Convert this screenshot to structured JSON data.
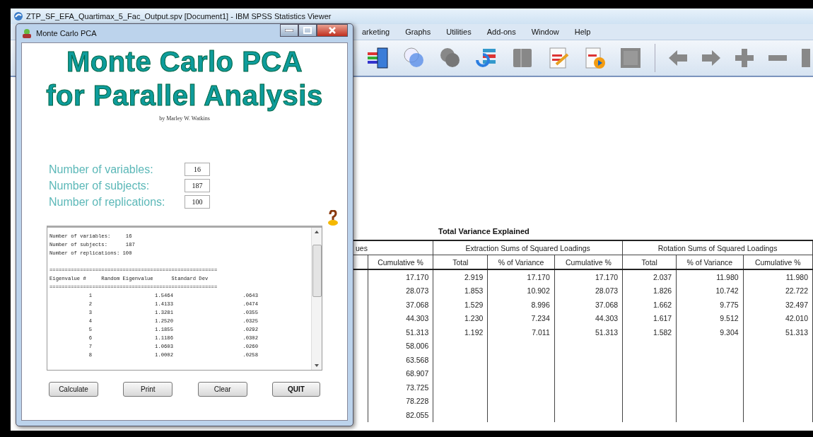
{
  "window": {
    "title": "ZTP_SF_EFA_Quartimax_5_Fac_Output.spv [Document1] - IBM SPSS Statistics Viewer"
  },
  "menu": [
    {
      "label": "arketing"
    },
    {
      "label": "Graphs"
    },
    {
      "label": "Utilities"
    },
    {
      "label": "Add-ons"
    },
    {
      "label": "Window"
    },
    {
      "label": "Help"
    }
  ],
  "dialog": {
    "title": "Monte Carlo PCA",
    "heading": [
      "Monte Carlo PCA",
      "for Parallel Analysis"
    ],
    "byline": "by Marley W. Watkins",
    "fields": [
      {
        "label": "Number of variables:",
        "value": "16"
      },
      {
        "label": "Number of subjects:",
        "value": "187"
      },
      {
        "label": "Number of replications:",
        "value": "100"
      }
    ],
    "output": {
      "info": [
        "Number of variables:     16",
        "Number of subjects:      187",
        "Number of replications: 100"
      ],
      "separator": "=======================================================",
      "header": "Eigenvalue #     Random Eigenvalue      Standard Dev",
      "rows": [
        [
          "1",
          "1.5464",
          ".0643"
        ],
        [
          "2",
          "1.4133",
          ".0474"
        ],
        [
          "3",
          "1.3281",
          ".0355"
        ],
        [
          "4",
          "1.2520",
          ".0325"
        ],
        [
          "5",
          "1.1855",
          ".0292"
        ],
        [
          "6",
          "1.1186",
          ".0302"
        ],
        [
          "7",
          "1.0603",
          ".0260"
        ],
        [
          "8",
          "1.0002",
          ".0258"
        ]
      ]
    },
    "buttons": [
      "Calculate",
      "Print",
      "Clear",
      "QUIT"
    ]
  },
  "output_table": {
    "title": "Total Variance Explained",
    "groups": [
      {
        "label": "ues"
      },
      {
        "label": "Extraction Sums of Squared Loadings"
      },
      {
        "label": "Rotation Sums of Squared Loadings"
      }
    ],
    "columns": [
      "Cumulative %",
      "Total",
      "% of Variance",
      "Cumulative %",
      "Total",
      "% of Variance",
      "Cumulative %"
    ],
    "rows": [
      [
        "17.170",
        "2.919",
        "17.170",
        "17.170",
        "2.037",
        "11.980",
        "11.980"
      ],
      [
        "28.073",
        "1.853",
        "10.902",
        "28.073",
        "1.826",
        "10.742",
        "22.722"
      ],
      [
        "37.068",
        "1.529",
        "8.996",
        "37.068",
        "1.662",
        "9.775",
        "32.497"
      ],
      [
        "44.303",
        "1.230",
        "7.234",
        "44.303",
        "1.617",
        "9.512",
        "42.010"
      ],
      [
        "51.313",
        "1.192",
        "7.011",
        "51.313",
        "1.582",
        "9.304",
        "51.313"
      ],
      [
        "58.006"
      ],
      [
        "63.568"
      ],
      [
        "68.907"
      ],
      [
        "73.725"
      ],
      [
        "78.228"
      ],
      [
        "82.055"
      ]
    ]
  }
}
